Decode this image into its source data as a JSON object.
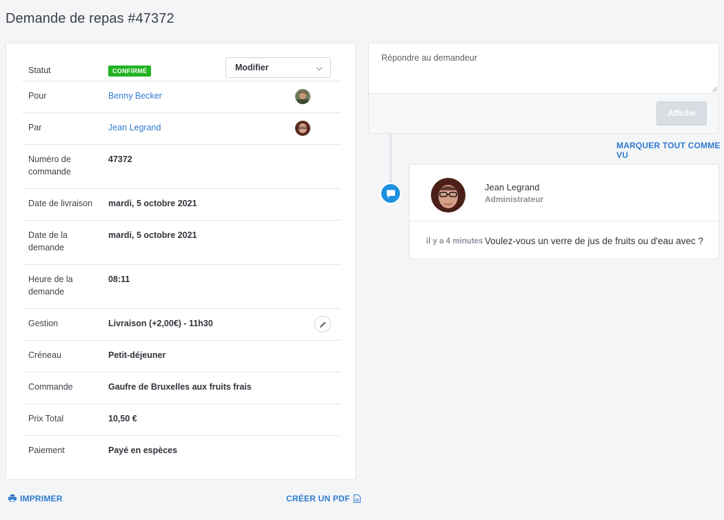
{
  "page": {
    "title": "Demande de repas #47372"
  },
  "details": {
    "statut": {
      "label": "Statut",
      "badge": "CONFIRMÉ",
      "action": "Modifier"
    },
    "pour": {
      "label": "Pour",
      "value": "Benny Becker"
    },
    "par": {
      "label": "Par",
      "value": "Jean Legrand"
    },
    "numero": {
      "label": "Numéro de commande",
      "value": "47372"
    },
    "date_livraison": {
      "label": "Date de livraison",
      "value": "mardi, 5 octobre 2021"
    },
    "date_demande": {
      "label": "Date de la demande",
      "value": "mardi, 5 octobre 2021"
    },
    "heure_demande": {
      "label": "Heure de la demande",
      "value": "08:11"
    },
    "gestion": {
      "label": "Gestion",
      "value": "Livraison (+2,00€) - 11h30"
    },
    "creneau": {
      "label": "Créneau",
      "value": "Petit-déjeuner"
    },
    "commande": {
      "label": "Commande",
      "value": "Gaufre de Bruxelles aux fruits frais"
    },
    "prix_total": {
      "label": "Prix Total",
      "value": "10,50 €"
    },
    "paiement": {
      "label": "Paiement",
      "value": "Payé en espèces"
    }
  },
  "actions": {
    "print": "IMPRIMER",
    "pdf": "CRÉER UN PDF"
  },
  "reply": {
    "placeholder": "Répondre au demandeur",
    "send_label": "Affiche",
    "mark_all": "MARQUER TOUT COMME VU"
  },
  "message": {
    "author": "Jean Legrand",
    "role": "Administrateur",
    "time": "il y a 4 minutes",
    "text": "Voulez-vous un verre de jus de fruits ou d'eau avec ?"
  },
  "colors": {
    "accent": "#2e7bcf",
    "badge_green": "#21b321",
    "timeline_blue": "#1e90e0"
  }
}
